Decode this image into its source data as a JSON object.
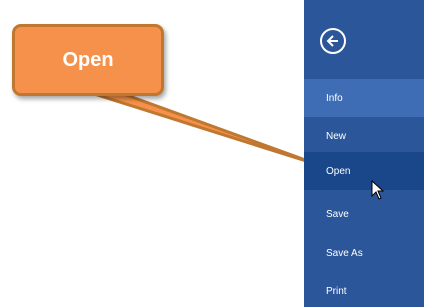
{
  "callout": {
    "label": "Open"
  },
  "file_menu": {
    "back_icon": "back-arrow-circle-icon",
    "items": [
      {
        "label": "Info",
        "state": "hover"
      },
      {
        "label": "New",
        "state": "normal"
      },
      {
        "label": "Open",
        "state": "selected"
      },
      {
        "label": "Save",
        "state": "normal"
      },
      {
        "label": "Save As",
        "state": "normal"
      },
      {
        "label": "Print",
        "state": "normal"
      }
    ]
  },
  "colors": {
    "menu_background": "#2b579a",
    "menu_hover": "#3e6db5",
    "menu_selected": "#19478a",
    "callout_fill": "#f5914a",
    "callout_border": "#c0772f"
  },
  "cursor_icon": "mouse-pointer-icon"
}
